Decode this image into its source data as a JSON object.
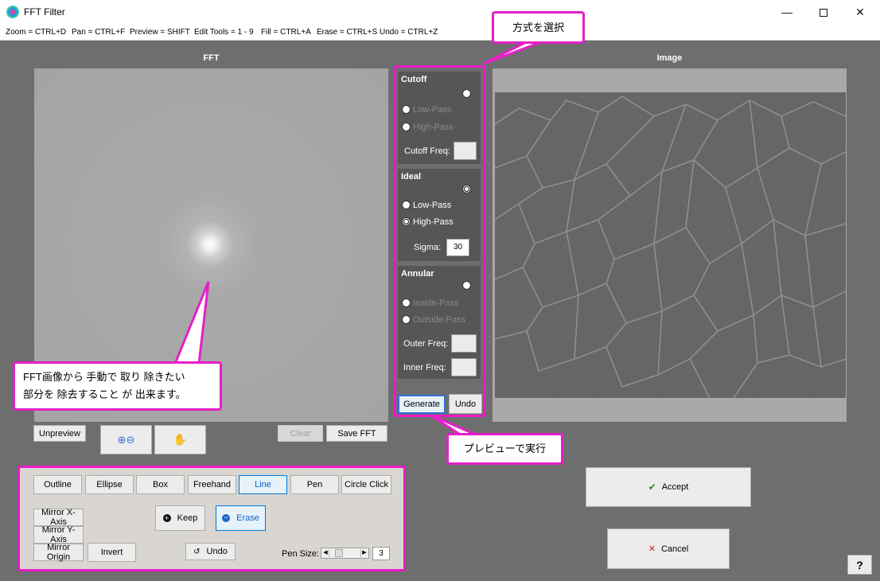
{
  "window": {
    "title": "FFT Filter",
    "min": "—",
    "close": "✕"
  },
  "shortcuts": [
    "Zoom = CTRL+D",
    "Pan = CTRL+F",
    "Preview = SHIFT",
    "Edit Tools = 1 - 9",
    "Fill = CTRL+A",
    "Erase = CTRL+S",
    "Undo = CTRL+Z"
  ],
  "fft": {
    "header": "FFT",
    "unpreview": "Unpreview",
    "clear": "Clear",
    "save_fft": "Save FFT"
  },
  "image": {
    "header": "Image"
  },
  "method": {
    "cutoff": {
      "title": "Cutoff",
      "low": "Low-Pass",
      "high": "High-Pass",
      "freq_label": "Cutoff Freq:",
      "freq_value": ""
    },
    "ideal": {
      "title": "Ideal",
      "low": "Low-Pass",
      "high": "High-Pass",
      "sigma_label": "Sigma:",
      "sigma_value": "30"
    },
    "annular": {
      "title": "Annular",
      "inside": "Inside-Pass",
      "outside": "Outside-Pass",
      "outer_label": "Outer Freq:",
      "outer_value": "",
      "inner_label": "Inner Freq:",
      "inner_value": ""
    },
    "generate": "Generate",
    "undo": "Undo"
  },
  "tools": {
    "shapes": [
      "Outline",
      "Ellipse",
      "Box",
      "Freehand",
      "Line",
      "Pen",
      "Circle Click"
    ],
    "mirror_x": "Mirror X-Axis",
    "mirror_y": "Mirror Y-Axis",
    "mirror_origin": "Mirror Origin",
    "invert": "Invert",
    "keep": "Keep",
    "erase": "Erase",
    "undo": "Undo",
    "pen_size_label": "Pen Size:",
    "pen_size_value": "3"
  },
  "actions": {
    "accept": "Accept",
    "cancel": "Cancel",
    "help": "?"
  },
  "callouts": {
    "method": "方式を選択",
    "fft_note": "FFT画像から 手動で 取り 除きたい\n部分を 除去すること が 出来ます。",
    "generate_note": "プレビューで実行"
  }
}
